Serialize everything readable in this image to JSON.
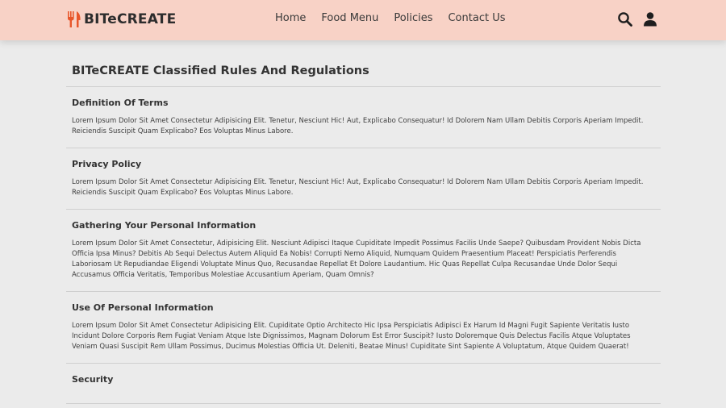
{
  "header": {
    "brand": "BITeCREATE",
    "nav": [
      "Home",
      "Food Menu",
      "Policies",
      "Contact Us"
    ],
    "icons": [
      "search-icon",
      "user-icon"
    ]
  },
  "colors": {
    "header_bg": "#f8d2c6",
    "accent": "#e8562a",
    "page_bg": "#ebebeb"
  },
  "page": {
    "title": "BITeCREATE Classified Rules And Regulations",
    "sections": [
      {
        "title": "Definition Of Terms",
        "body": "Lorem Ipsum Dolor Sit Amet Consectetur Adipisicing Elit. Tenetur, Nesciunt Hic! Aut, Explicabo Consequatur! Id Dolorem Nam Ullam Debitis Corporis Aperiam Impedit. Reiciendis Suscipit Quam Explicabo? Eos Voluptas Minus Labore."
      },
      {
        "title": "Privacy Policy",
        "body": "Lorem Ipsum Dolor Sit Amet Consectetur Adipisicing Elit. Tenetur, Nesciunt Hic! Aut, Explicabo Consequatur! Id Dolorem Nam Ullam Debitis Corporis Aperiam Impedit. Reiciendis Suscipit Quam Explicabo? Eos Voluptas Minus Labore."
      },
      {
        "title": "Gathering Your Personal Information",
        "body": "Lorem Ipsum Dolor Sit Amet Consectetur, Adipisicing Elit. Nesciunt Adipisci Itaque Cupiditate Impedit Possimus Facilis Unde Saepe? Quibusdam Provident Nobis Dicta Officia Ipsa Minus? Debitis Ab Sequi Delectus Autem Aliquid Ea Nobis! Corrupti Nemo Aliquid, Numquam Quidem Praesentium Placeat! Perspiciatis Perferendis Laboriosam Ut Repudiandae Eligendi Voluptate Minus Quo, Recusandae Repellat Et Dolore Laudantium. Hic Quas Repellat Culpa Recusandae Unde Dolor Sequi Accusamus Officia Veritatis, Temporibus Molestiae Accusantium Aperiam, Quam Omnis?"
      },
      {
        "title": "Use Of Personal Information",
        "body": "Lorem Ipsum Dolor Sit Amet Consectetur Adipisicing Elit. Cupiditate Optio Architecto Hic Ipsa Perspiciatis Adipisci Ex Harum Id Magni Fugit Sapiente Veritatis Iusto Incidunt Dolore Corporis Rem Fugiat Veniam Atque Iste Dignissimos, Magnam Dolorum Est Error Suscipit? Iusto Doloremque Quis Delectus Facilis Atque Voluptates Veniam Quasi Suscipit Rem Ullam Possimus, Ducimus Molestias Officia Ut. Deleniti, Beatae Minus! Cupiditate Sint Sapiente A Voluptatum, Atque Quidem Quaerat!"
      },
      {
        "title": "Security",
        "body": ""
      }
    ]
  }
}
